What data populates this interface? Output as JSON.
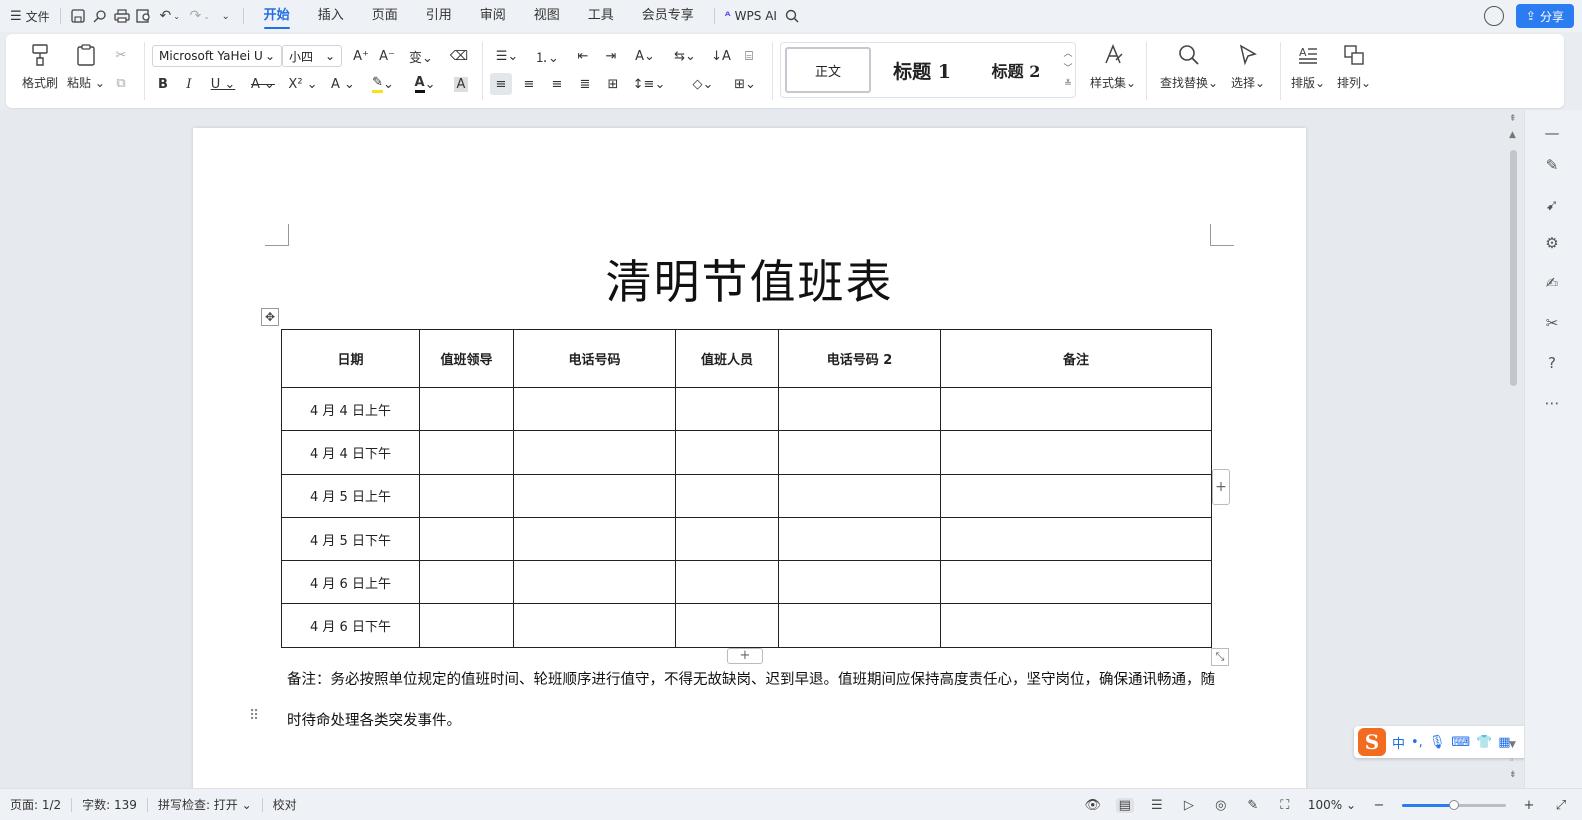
{
  "menubar": {
    "file_label": "文件",
    "tabs": [
      "开始",
      "插入",
      "页面",
      "引用",
      "审阅",
      "视图",
      "工具",
      "会员专享"
    ],
    "active_tab": "开始",
    "wps_ai_label": "WPS AI",
    "share_label": "分享"
  },
  "ribbon": {
    "format_painter": "格式刷",
    "paste": "粘贴",
    "font_name": "Microsoft YaHei U",
    "font_size": "小四",
    "styles": [
      "正文",
      "标题 1",
      "标题 2"
    ],
    "style_set": "样式集",
    "find_replace": "查找替换",
    "select": "选择",
    "layout": "排版",
    "arrange": "排列"
  },
  "document": {
    "title": "清明节值班表",
    "table": {
      "headers": [
        "日期",
        "值班领导",
        "电话号码",
        "值班人员",
        "电话号码 2",
        "备注"
      ],
      "rows": [
        "4 月 4 日上午",
        "4 月 4 日下午",
        "4 月 5 日上午",
        "4 月 5 日下午",
        "4 月 6 日上午",
        "4 月 6 日下午"
      ]
    },
    "note": "备注：务必按照单位规定的值班时间、轮班顺序进行值守，不得无故缺岗、迟到早退。值班期间应保持高度责任心，坚守岗位，确保通讯畅通，随时待命处理各类突发事件。"
  },
  "ime": {
    "mode_label": "中"
  },
  "statusbar": {
    "page": "页面: 1/2",
    "word_count": "字数: 139",
    "spell_check": "拼写检查: 打开",
    "proofread": "校对",
    "zoom": "100%",
    "zoom_fraction": 0.5
  },
  "colors": {
    "accent": "#1f6fe5",
    "share_bg": "#2b7cf0",
    "ime_logo": "#f26b1f"
  }
}
